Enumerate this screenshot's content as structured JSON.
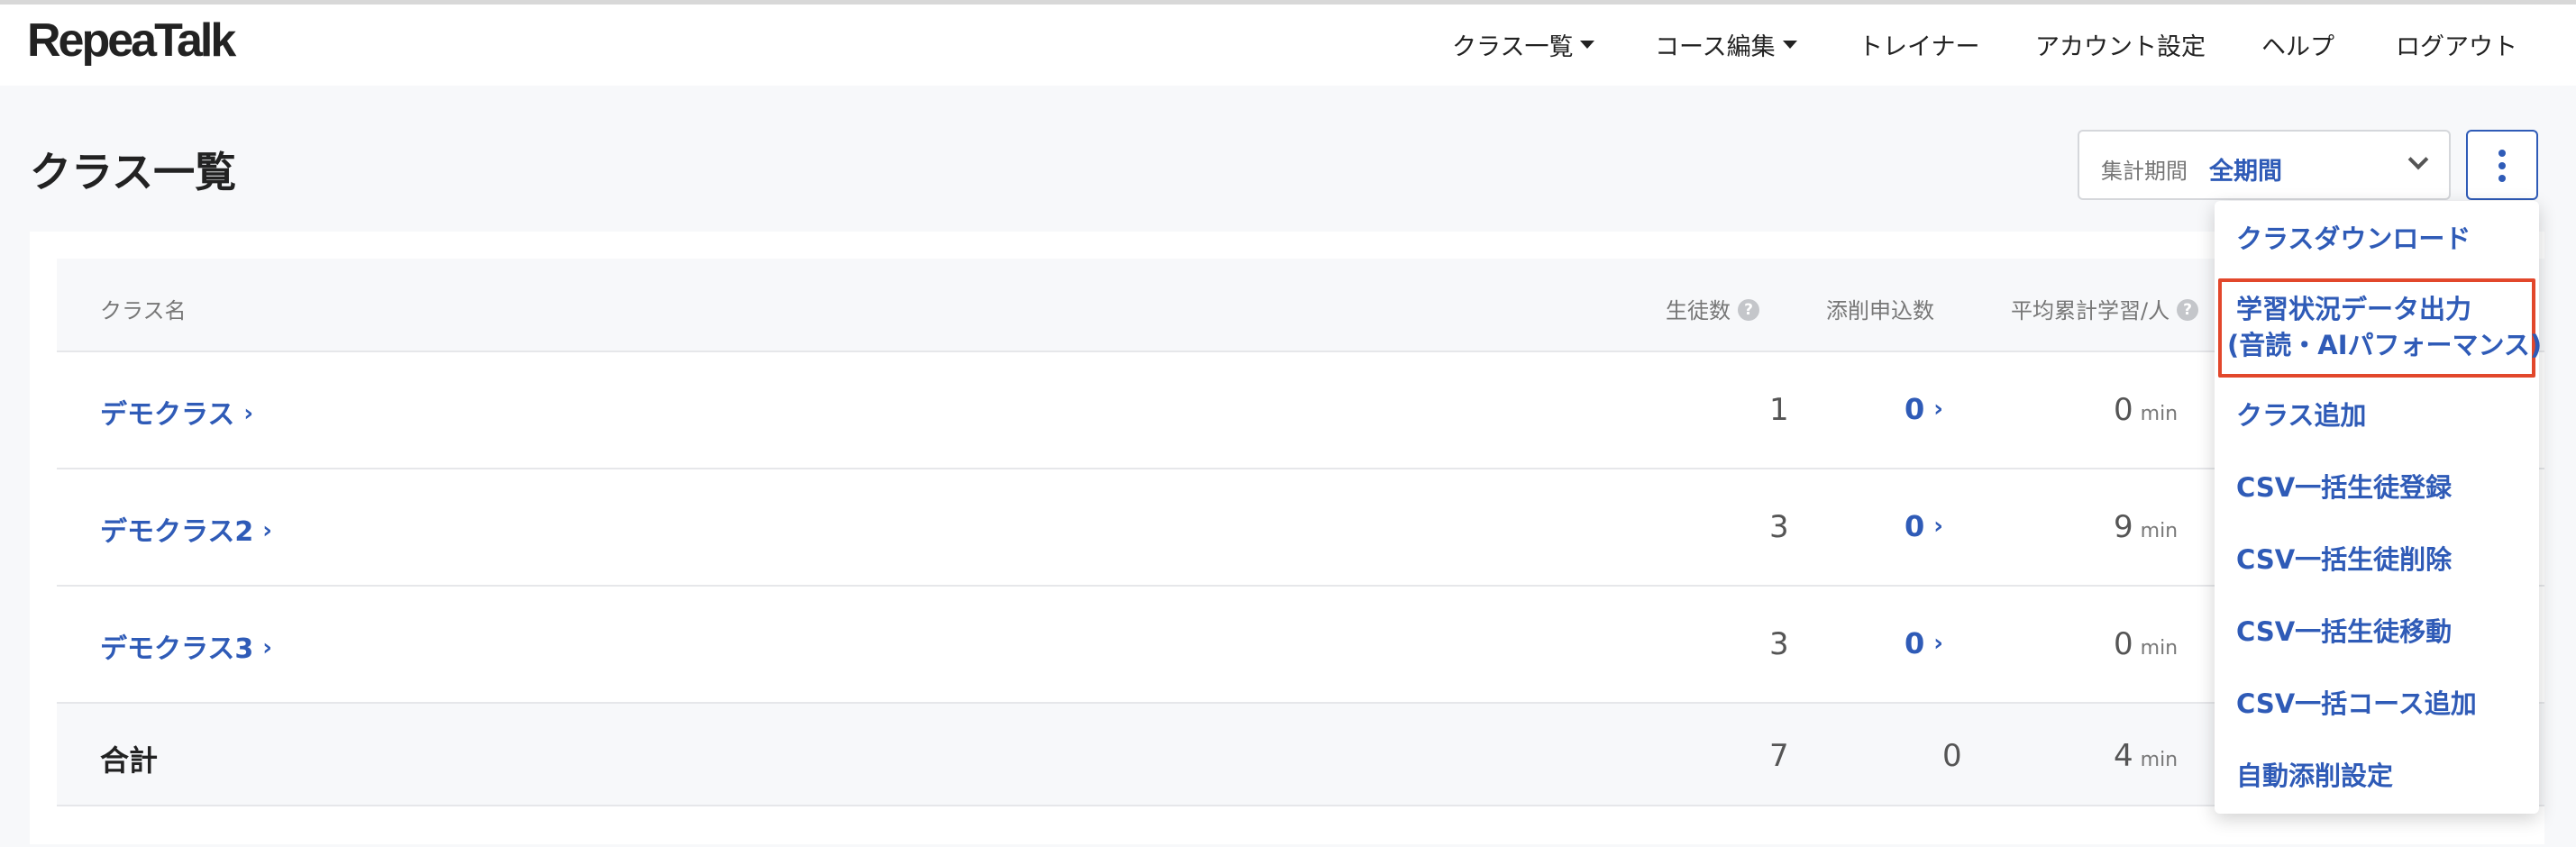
{
  "app": {
    "logo": "RepeaTalk"
  },
  "nav": {
    "class_list": "クラス一覧",
    "course_edit": "コース編集",
    "trainer": "トレイナー",
    "account_settings": "アカウント設定",
    "help": "ヘルプ",
    "logout": "ログアウト"
  },
  "page": {
    "title": "クラス一覧"
  },
  "period": {
    "label": "集計期間",
    "value": "全期間"
  },
  "table": {
    "headers": {
      "class_name": "クラス名",
      "students": "生徒数",
      "submissions": "添削申込数",
      "avg_study": "平均累計学習/人"
    },
    "unit": "min",
    "rows": [
      {
        "name": "デモクラス",
        "students": "1",
        "submissions": "0",
        "avg": "0"
      },
      {
        "name": "デモクラス2",
        "students": "3",
        "submissions": "0",
        "avg": "9"
      },
      {
        "name": "デモクラス3",
        "students": "3",
        "submissions": "0",
        "avg": "0"
      }
    ],
    "total": {
      "label": "合計",
      "students": "7",
      "submissions": "0",
      "avg": "4"
    }
  },
  "menu": {
    "items": [
      "クラスダウンロード",
      "学習状況データ出力",
      "(音読・AIパフォーマンス)",
      "クラス追加",
      "CSV一括生徒登録",
      "CSV一括生徒削除",
      "CSV一括生徒移動",
      "CSV一括コース追加",
      "自動添削設定"
    ]
  },
  "colors": {
    "accent": "#2f5bb7",
    "highlight": "#e2472b",
    "background": "#f7f8fa"
  }
}
